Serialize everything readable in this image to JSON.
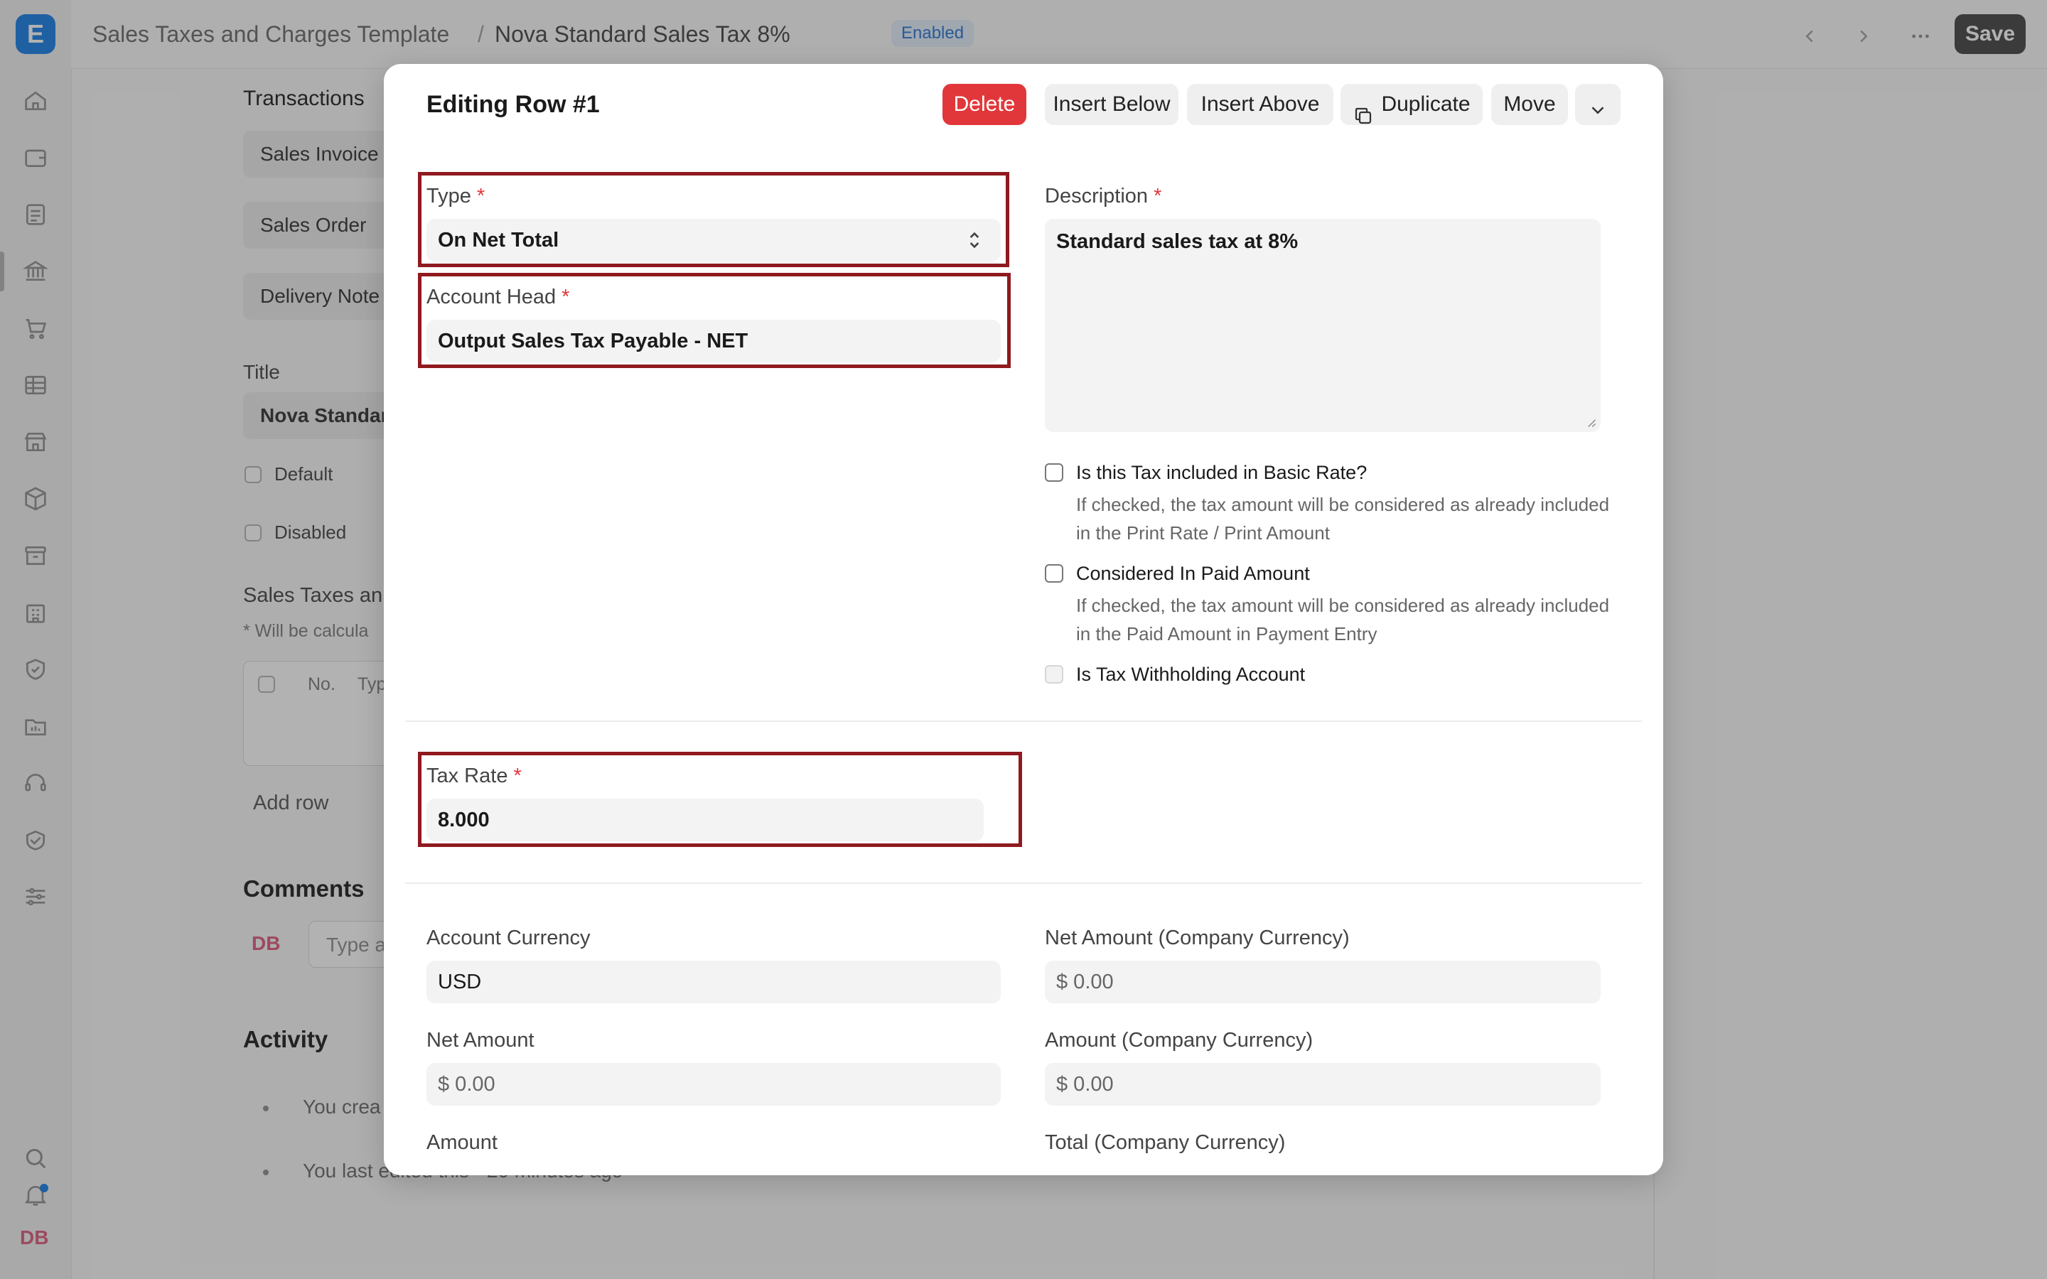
{
  "app": {
    "logo_letter": "E",
    "avatar": "DB"
  },
  "header": {
    "breadcrumb_parent": "Sales Taxes and Charges Template",
    "breadcrumb_sep": "/",
    "doc_title": "Nova Standard Sales Tax 8%",
    "status_badge": "Enabled",
    "save_label": "Save"
  },
  "background_form": {
    "transactions_label": "Transactions",
    "transaction_links": [
      "Sales Invoice",
      "Sales Order",
      "Delivery Note"
    ],
    "title_label": "Title",
    "title_value": "Nova Standar",
    "default_label": "Default",
    "disabled_label": "Disabled",
    "taxes_section": "Sales Taxes an",
    "taxes_note": "* Will be calcula",
    "table_headers": [
      "No.",
      "Typ"
    ],
    "add_row": "Add row",
    "comments_heading": "Comments",
    "comment_avatar": "DB",
    "comment_placeholder": "Type a",
    "activity_heading": "Activity",
    "activity_items": [
      "You crea",
      "You last edited this · 20 minutes ago"
    ]
  },
  "modal": {
    "title": "Editing Row #1",
    "buttons": {
      "delete": "Delete",
      "insert_below": "Insert Below",
      "insert_above": "Insert Above",
      "duplicate": "Duplicate",
      "move": "Move"
    },
    "type_label": "Type",
    "type_value": "On Net Total",
    "account_head_label": "Account Head",
    "account_head_value": "Output Sales Tax Payable - NET",
    "description_label": "Description",
    "description_value": "Standard sales tax at 8%",
    "checkbox_included_label": "Is this Tax included in Basic Rate?",
    "checkbox_included_help": "If checked, the tax amount will be considered as already included in the Print Rate / Print Amount",
    "checkbox_paid_label": "Considered In Paid Amount",
    "checkbox_paid_help": "If checked, the tax amount will be considered as already included in the Paid Amount in Payment Entry",
    "checkbox_withholding_label": "Is Tax Withholding Account",
    "tax_rate_label": "Tax Rate",
    "tax_rate_value": "8.000",
    "account_currency_label": "Account Currency",
    "account_currency_value": "USD",
    "net_amount_company_label": "Net Amount (Company Currency)",
    "net_amount_company_value": "$ 0.00",
    "net_amount_label": "Net Amount",
    "net_amount_value": "$ 0.00",
    "amount_company_label": "Amount (Company Currency)",
    "amount_company_value": "$ 0.00",
    "amount_label": "Amount",
    "total_company_label": "Total (Company Currency)",
    "required_mark": "*"
  },
  "colors": {
    "danger": "#e2373a",
    "highlight": "#8f1a1f",
    "brand": "#2d8ae8"
  }
}
